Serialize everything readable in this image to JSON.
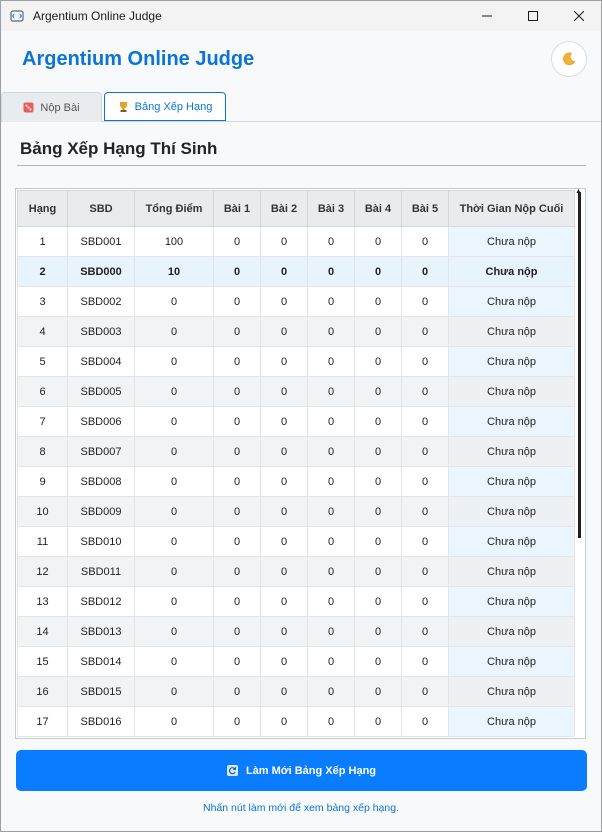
{
  "window": {
    "title": "Argentium Online Judge"
  },
  "header": {
    "app_title": "Argentium Online Judge",
    "theme_toggle_icon": "moon-icon"
  },
  "tabs": [
    {
      "label": "Nộp Bài",
      "icon": "dice-icon",
      "active": false
    },
    {
      "label": "Bảng Xếp Hạng",
      "icon": "trophy-icon",
      "active": true
    }
  ],
  "section": {
    "title": "Bảng Xếp Hạng Thí Sinh"
  },
  "table": {
    "columns": [
      "Hạng",
      "SBD",
      "Tổng Điểm",
      "Bài 1",
      "Bài 2",
      "Bài 3",
      "Bài 4",
      "Bài 5",
      "Thời Gian Nộp Cuối"
    ],
    "highlighted_row": 1,
    "rows": [
      [
        "1",
        "SBD001",
        "100",
        "0",
        "0",
        "0",
        "0",
        "0",
        "Chưa nộp"
      ],
      [
        "2",
        "SBD000",
        "10",
        "0",
        "0",
        "0",
        "0",
        "0",
        "Chưa nộp"
      ],
      [
        "3",
        "SBD002",
        "0",
        "0",
        "0",
        "0",
        "0",
        "0",
        "Chưa nộp"
      ],
      [
        "4",
        "SBD003",
        "0",
        "0",
        "0",
        "0",
        "0",
        "0",
        "Chưa nộp"
      ],
      [
        "5",
        "SBD004",
        "0",
        "0",
        "0",
        "0",
        "0",
        "0",
        "Chưa nộp"
      ],
      [
        "6",
        "SBD005",
        "0",
        "0",
        "0",
        "0",
        "0",
        "0",
        "Chưa nộp"
      ],
      [
        "7",
        "SBD006",
        "0",
        "0",
        "0",
        "0",
        "0",
        "0",
        "Chưa nộp"
      ],
      [
        "8",
        "SBD007",
        "0",
        "0",
        "0",
        "0",
        "0",
        "0",
        "Chưa nộp"
      ],
      [
        "9",
        "SBD008",
        "0",
        "0",
        "0",
        "0",
        "0",
        "0",
        "Chưa nộp"
      ],
      [
        "10",
        "SBD009",
        "0",
        "0",
        "0",
        "0",
        "0",
        "0",
        "Chưa nộp"
      ],
      [
        "11",
        "SBD010",
        "0",
        "0",
        "0",
        "0",
        "0",
        "0",
        "Chưa nộp"
      ],
      [
        "12",
        "SBD011",
        "0",
        "0",
        "0",
        "0",
        "0",
        "0",
        "Chưa nộp"
      ],
      [
        "13",
        "SBD012",
        "0",
        "0",
        "0",
        "0",
        "0",
        "0",
        "Chưa nộp"
      ],
      [
        "14",
        "SBD013",
        "0",
        "0",
        "0",
        "0",
        "0",
        "0",
        "Chưa nộp"
      ],
      [
        "15",
        "SBD014",
        "0",
        "0",
        "0",
        "0",
        "0",
        "0",
        "Chưa nộp"
      ],
      [
        "16",
        "SBD015",
        "0",
        "0",
        "0",
        "0",
        "0",
        "0",
        "Chưa nộp"
      ],
      [
        "17",
        "SBD016",
        "0",
        "0",
        "0",
        "0",
        "0",
        "0",
        "Chưa nộp"
      ]
    ]
  },
  "refresh": {
    "label": "Làm Mới Bảng Xếp Hạng",
    "icon": "refresh-icon"
  },
  "hint": "Nhấn nút làm mới để xem bảng xếp hạng.",
  "colors": {
    "accent": "#0a7cff",
    "title_blue": "#0b74d9",
    "highlight_row": "#e8f4fc"
  }
}
